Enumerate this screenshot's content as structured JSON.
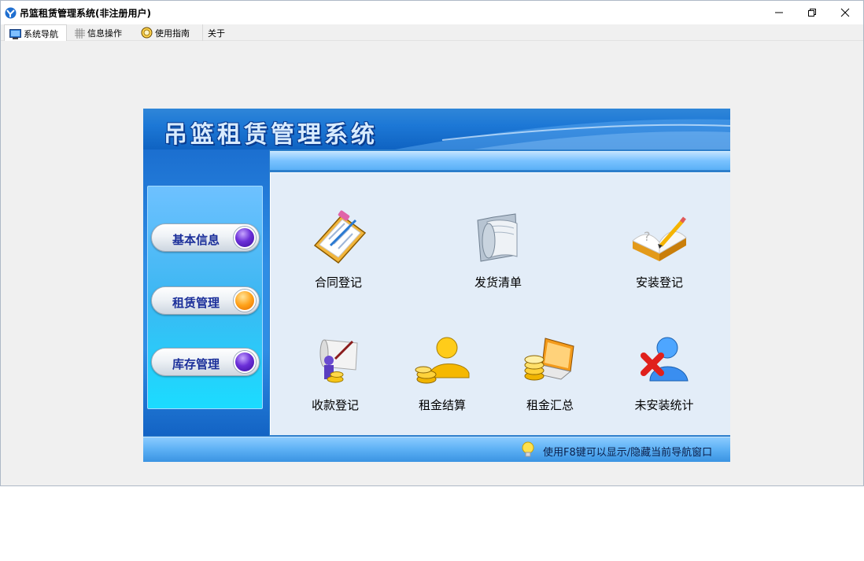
{
  "window": {
    "title": "吊篮租赁管理系统(非注册用户)"
  },
  "menu": {
    "tabs": [
      {
        "label": "系统导航",
        "icon": "monitor-icon"
      },
      {
        "label": "信息操作",
        "icon": "grid-icon"
      },
      {
        "label": "使用指南",
        "icon": "compass-icon"
      },
      {
        "label": "关于",
        "icon": ""
      }
    ]
  },
  "banner": {
    "title": "吊篮租赁管理系统"
  },
  "sidebar": {
    "buttons": [
      {
        "label": "基本信息",
        "dot_color": "#6b2fd8"
      },
      {
        "label": "租赁管理",
        "dot_color": "#ffa21a"
      },
      {
        "label": "库存管理",
        "dot_color": "#6b2fd8"
      }
    ]
  },
  "items": [
    {
      "label": "合同登记",
      "icon": "contract-clipboard-icon"
    },
    {
      "label": "发货清单",
      "icon": "folder-scroll-icon"
    },
    {
      "label": "安装登记",
      "icon": "open-book-pencil-icon"
    },
    {
      "label": "收款登记",
      "icon": "presentation-coins-icon"
    },
    {
      "label": "租金结算",
      "icon": "gold-user-coins-icon"
    },
    {
      "label": "租金汇总",
      "icon": "laptop-coins-icon"
    },
    {
      "label": "未安装统计",
      "icon": "user-delete-icon"
    }
  ],
  "status": {
    "text": "使用F8键可以显示/隐藏当前导航窗口",
    "icon": "lightbulb-icon"
  },
  "colors": {
    "banner": "#1d78d6",
    "content_bg": "#e3edf8",
    "pill_text": "#1b2f9a"
  }
}
